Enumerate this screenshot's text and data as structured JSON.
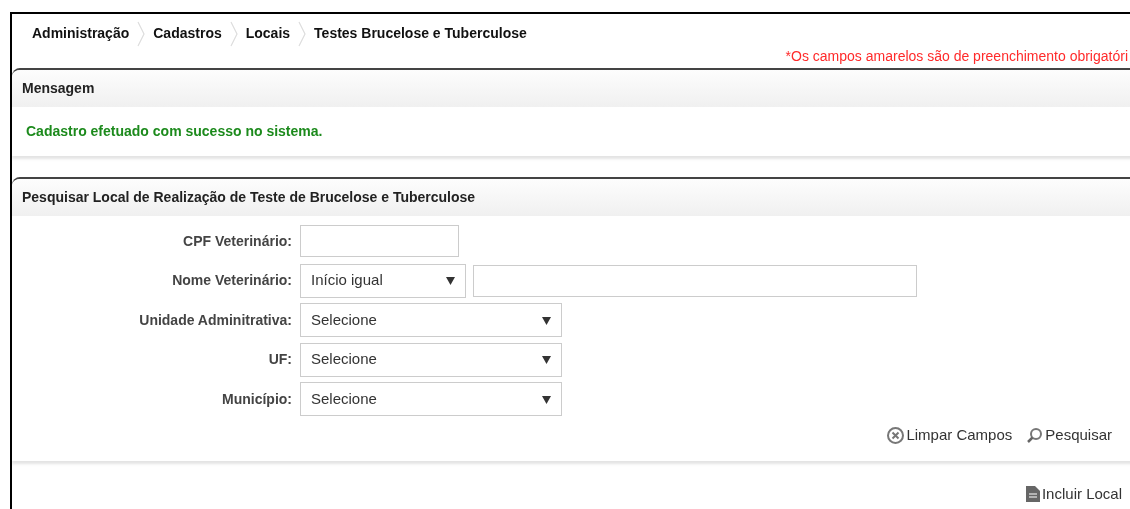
{
  "breadcrumb": [
    "Administração",
    "Cadastros",
    "Locais",
    "Testes Brucelose e Tuberculose"
  ],
  "required_note": "*Os campos amarelos são de preenchimento obrigatóri",
  "message_panel": {
    "title": "Mensagem",
    "message": "Cadastro efetuado com sucesso no sistema."
  },
  "search_panel": {
    "title": "Pesquisar Local de Realização de Teste de Brucelose e Tuberculose",
    "fields": [
      {
        "label": "CPF Veterinário:",
        "kind": "text"
      },
      {
        "label": "Nome Veterinário:",
        "kind": "select-text",
        "selected_option": "Início igual"
      },
      {
        "label": "Unidade Adminitrativa:",
        "kind": "select",
        "selected_option": "Selecione"
      },
      {
        "label": "UF:",
        "kind": "select",
        "selected_option": "Selecione"
      },
      {
        "label": "Município:",
        "kind": "select",
        "selected_option": "Selecione"
      }
    ],
    "actions": [
      {
        "label": "Limpar Campos",
        "kind": "clear"
      },
      {
        "label": "Pesquisar",
        "kind": "search"
      }
    ]
  },
  "footer_action": {
    "label": "Incluir Local"
  }
}
